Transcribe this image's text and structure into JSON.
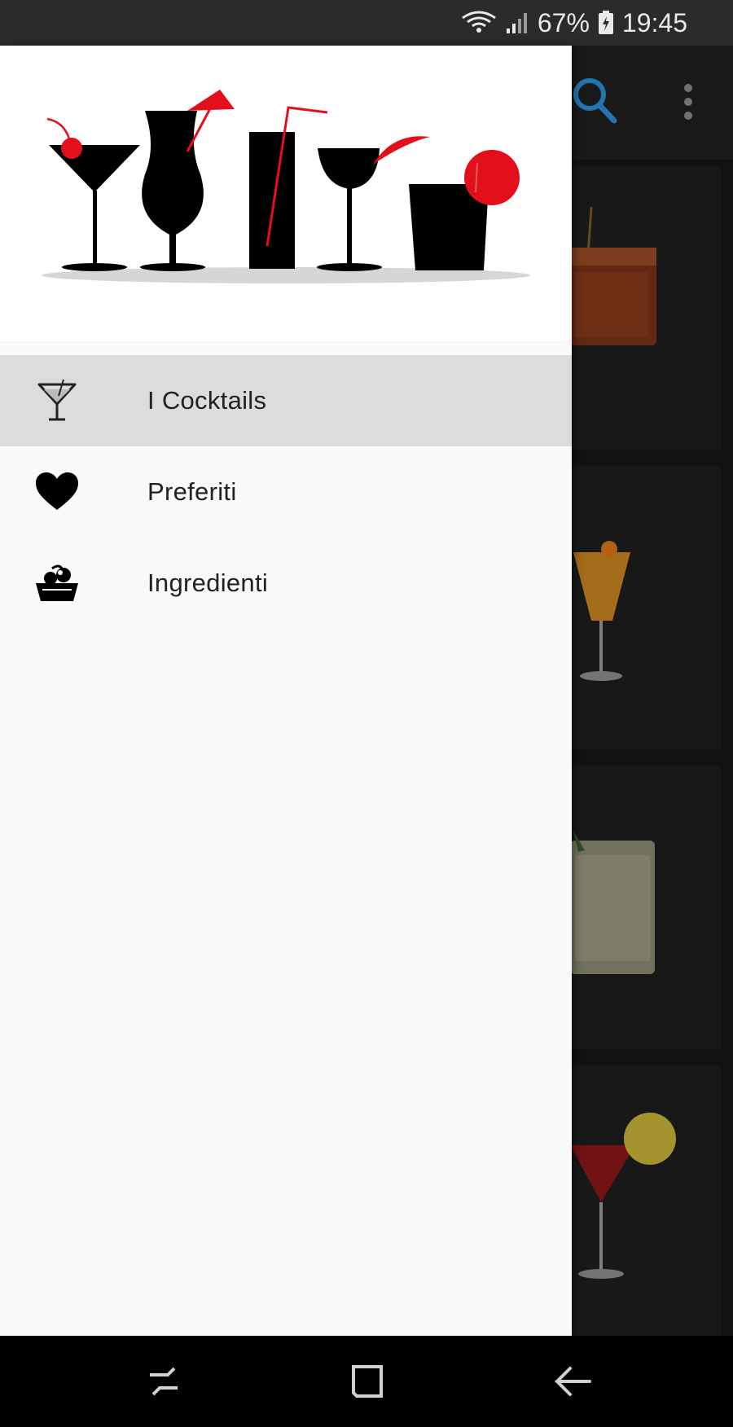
{
  "status_bar": {
    "battery": "67%",
    "time": "19:45",
    "wifi_icon": "wifi-icon",
    "signal_icon": "signal-icon",
    "battery_icon": "battery-icon"
  },
  "toolbar": {
    "search_icon": "search-icon",
    "overflow_icon": "more-vert-icon",
    "accent_color": "#2b8fd6"
  },
  "drawer": {
    "header_image": "cocktail-glasses-banner",
    "items": [
      {
        "label": "I Cocktails",
        "icon": "cocktail-glass-icon",
        "active": true
      },
      {
        "label": "Preferiti",
        "icon": "heart-icon",
        "active": false
      },
      {
        "label": "Ingredienti",
        "icon": "basket-icon",
        "active": false
      }
    ]
  },
  "nav_bar": {
    "recents_icon": "recents-icon",
    "home_icon": "home-icon",
    "back_icon": "back-icon"
  },
  "colors": {
    "brand_red": "#e3101b",
    "active_item_bg": "#dcdcdc"
  }
}
